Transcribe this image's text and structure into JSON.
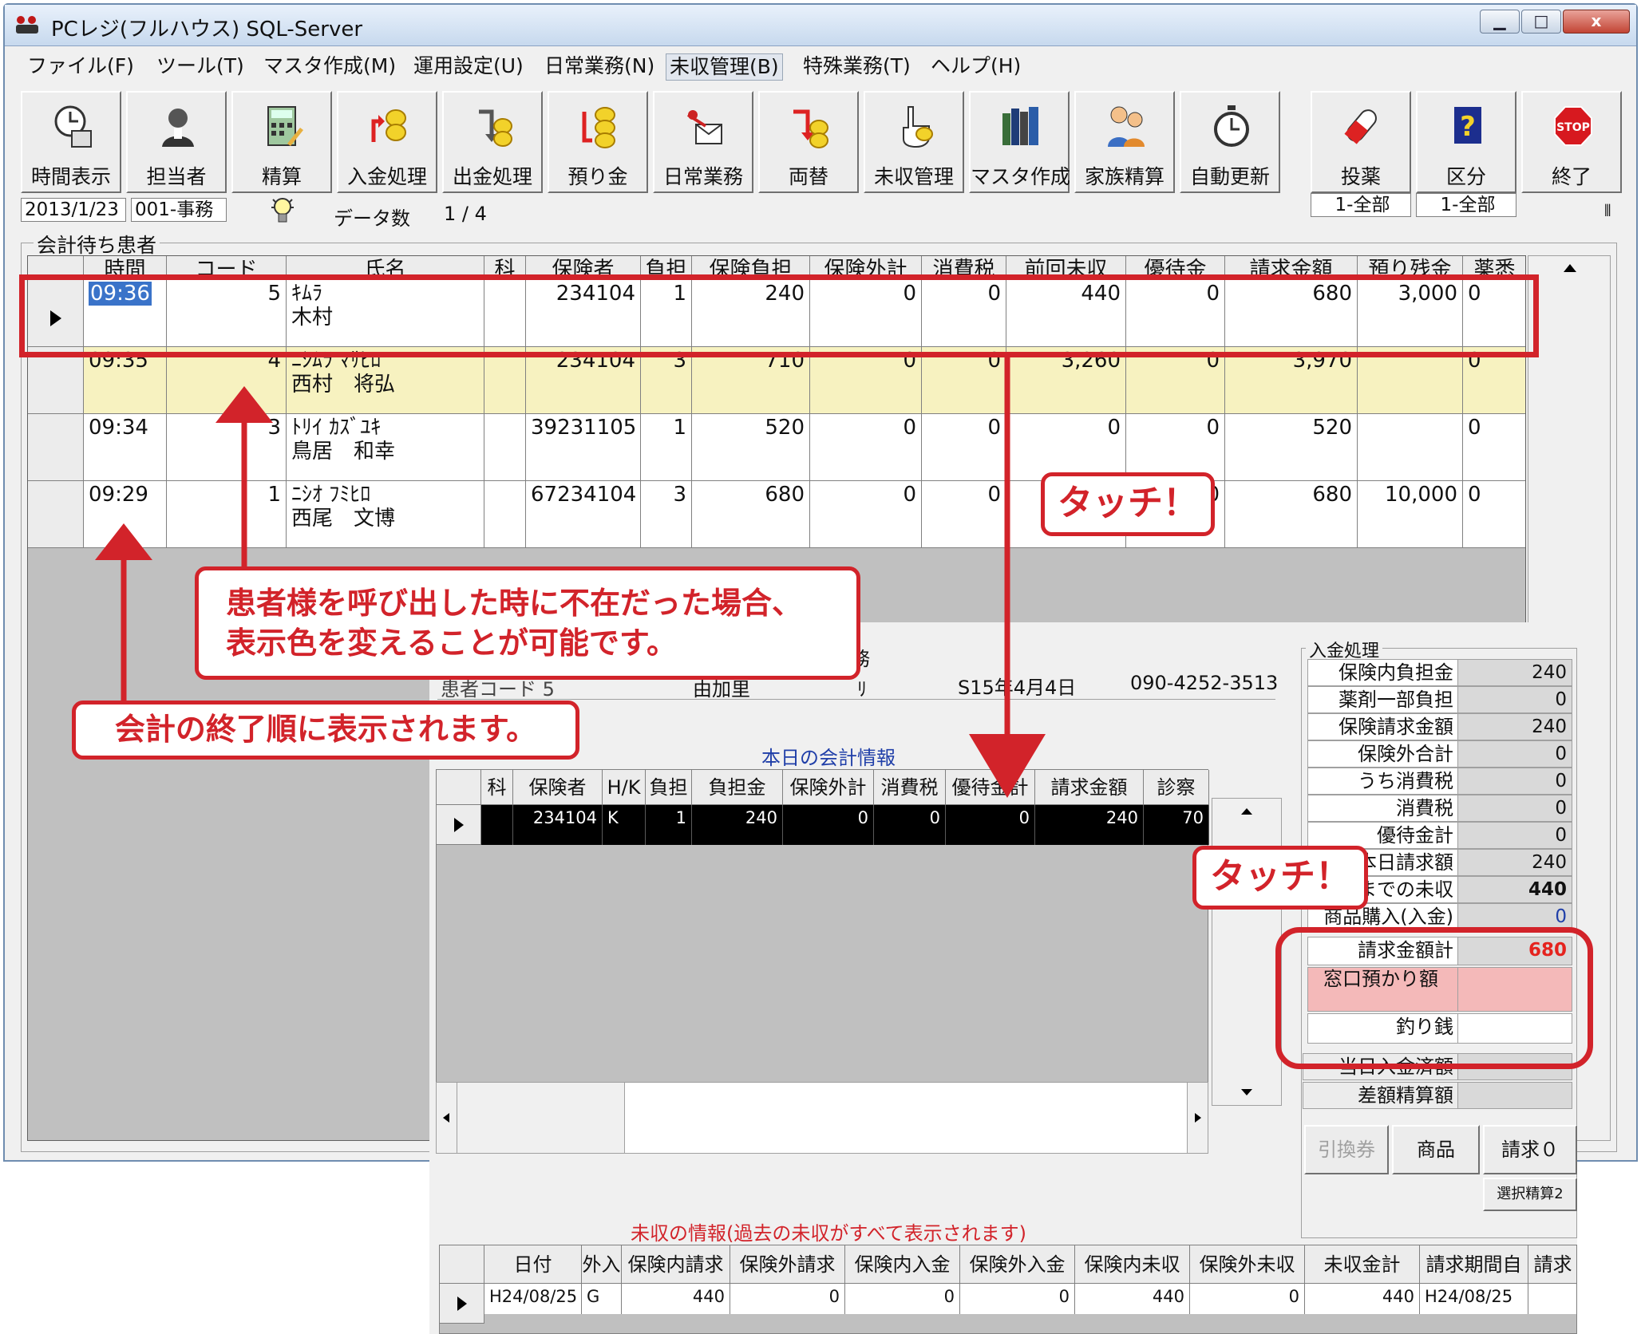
{
  "window": {
    "title": "PCレジ(フルハウス) SQL-Server",
    "controls": {
      "minimize": "▁",
      "maximize": "□",
      "close": "x"
    }
  },
  "menu": [
    {
      "label": "ファイル(F)"
    },
    {
      "label": "ツール(T)"
    },
    {
      "label": "マスタ作成(M)"
    },
    {
      "label": "運用設定(U)"
    },
    {
      "label": "日常業務(N)"
    },
    {
      "label": "未収管理(B)"
    },
    {
      "label": "特殊業務(T)"
    },
    {
      "label": "ヘルプ(H)"
    }
  ],
  "toolbar": [
    {
      "label": "時間表示",
      "icon": "clock-calendar-icon"
    },
    {
      "label": "担当者",
      "icon": "staff-person-icon"
    },
    {
      "label": "精算",
      "icon": "calculator-icon"
    },
    {
      "label": "入金処理",
      "icon": "coin-in-icon"
    },
    {
      "label": "出金処理",
      "icon": "coin-out-icon"
    },
    {
      "label": "預り金",
      "icon": "deposit-coins-icon"
    },
    {
      "label": "日常業務",
      "icon": "daily-work-icon"
    },
    {
      "label": "両替",
      "icon": "exchange-icon"
    },
    {
      "label": "未収管理",
      "icon": "hand-coin-icon"
    },
    {
      "label": "マスタ作成",
      "icon": "books-icon"
    },
    {
      "label": "家族精算",
      "icon": "family-icon"
    },
    {
      "label": "自動更新",
      "icon": "stopwatch-icon"
    },
    {
      "label": "投薬",
      "icon": "medicine-icon"
    },
    {
      "label": "区分",
      "icon": "question-book-icon"
    },
    {
      "label": "終了",
      "icon": "stop-sign-icon"
    }
  ],
  "status": {
    "date": "2013/1/23",
    "staff": "001-事務",
    "count_label": "データ数",
    "count_value": "1 / 4",
    "medicine_filter": "1-全部",
    "category_filter": "1-全部",
    "stop_text": "STOP"
  },
  "waiting": {
    "group_title": "会計待ち患者",
    "columns": [
      "時間",
      "コード",
      "氏名",
      "科",
      "保険者",
      "負担",
      "保険負担",
      "保険外計",
      "消費税",
      "前回未収",
      "優待金",
      "請求金額",
      "預り残金",
      "薬悉"
    ],
    "rows": [
      {
        "time": "09:36",
        "code": "5",
        "kana": "ｷﾑﾗ",
        "name": "木村",
        "ka": "",
        "insurer": "234104",
        "futan": "1",
        "hoken_futan": "240",
        "hokengai": "0",
        "tax": "0",
        "zenkai": "440",
        "yutai": "0",
        "seikyu": "680",
        "azukari": "3,000",
        "yaku": "0"
      },
      {
        "time": "09:35",
        "code": "4",
        "kana": "ﾆｼﾑﾗ ﾏｻﾋﾛ",
        "name": "西村　将弘",
        "ka": "",
        "insurer": "234104",
        "futan": "3",
        "hoken_futan": "710",
        "hokengai": "0",
        "tax": "0",
        "zenkai": "3,260",
        "yutai": "0",
        "seikyu": "3,970",
        "azukari": "",
        "yaku": "0"
      },
      {
        "time": "09:34",
        "code": "3",
        "kana": "ﾄﾘｲ ｶｽﾞﾕｷ",
        "name": "鳥居　和幸",
        "ka": "",
        "insurer": "39231105",
        "futan": "1",
        "hoken_futan": "520",
        "hokengai": "0",
        "tax": "0",
        "zenkai": "0",
        "yutai": "0",
        "seikyu": "520",
        "azukari": "",
        "yaku": "0"
      },
      {
        "time": "09:29",
        "code": "1",
        "kana": "ﾆｼｵ ﾌﾐﾋﾛ",
        "name": "西尾　文博",
        "ka": "",
        "insurer": "67234104",
        "futan": "3",
        "hoken_futan": "680",
        "hokengai": "0",
        "tax": "0",
        "zenkai": "",
        "yutai": "0",
        "seikyu": "680",
        "azukari": "10,000",
        "yaku": "0"
      }
    ]
  },
  "patient_info": {
    "label_partial": "務",
    "number_partial": "患者コード 5",
    "address_partial": "由加里",
    "relation_partial": "ﾘ",
    "birthdate": "S15年4月4日",
    "phone": "090-4252-3513"
  },
  "today": {
    "title": "本日の会計情報",
    "columns": [
      "科",
      "保険者",
      "H/K",
      "負担",
      "負担金",
      "保険外計",
      "消費税",
      "優待金計",
      "請求金額",
      "診察"
    ],
    "row": {
      "ka": "",
      "insurer": "234104",
      "hk": "K",
      "futan": "1",
      "futankin": "240",
      "hokengai": "0",
      "tax": "0",
      "yutai": "0",
      "seikyu": "240",
      "shinsatsu": "70"
    }
  },
  "payment": {
    "group_title": "入金処理",
    "rows": [
      {
        "label": "保険内負担金",
        "value": "240"
      },
      {
        "label": "薬剤一部負担",
        "value": "0"
      },
      {
        "label": "保険請求金額",
        "value": "240"
      },
      {
        "label": "保険外合計",
        "value": "0"
      },
      {
        "label": "うち消費税",
        "value": "0"
      },
      {
        "label": "消費税",
        "value": "0"
      },
      {
        "label": "優待金計",
        "value": "0"
      },
      {
        "label": "本日請求額",
        "value": "240"
      },
      {
        "label": "前回までの未収",
        "value": "440"
      },
      {
        "label": "商品購入(入金)",
        "value": "0"
      }
    ],
    "total_label": "請求金額計",
    "total_value": "680",
    "deposit_label": "窓口預かり額",
    "deposit_value": "",
    "change_label": "釣り銭",
    "change_value": "",
    "today_paid_label": "当日入金済額",
    "diff_label": "差額精算額",
    "buttons": {
      "voucher": "引換券",
      "goods": "商品",
      "bill": "請求０",
      "select": "選択精算2"
    }
  },
  "uncollected": {
    "title": "未収の情報(過去の未収がすべて表示されます)",
    "columns": [
      "日付",
      "外入",
      "保険内請求",
      "保険外請求",
      "保険内入金",
      "保険外入金",
      "保険内未収",
      "保険外未収",
      "未収金計",
      "請求期間自",
      "請求"
    ],
    "row": {
      "date": "H24/08/25",
      "gainyu": "G",
      "in_seikyu": "440",
      "out_seikyu": "0",
      "in_nyukin": "0",
      "out_nyukin": "0",
      "in_mishu": "440",
      "out_mishu": "0",
      "total": "440",
      "from": "H24/08/25"
    }
  },
  "annotations": {
    "touch1": "タッチ！",
    "touch2": "タッチ！",
    "absent_line1": "患者様を呼び出した時に不在だった場合、",
    "absent_line2": "表示色を変えることが可能です。",
    "order": "会計の終了順に表示されます。",
    "accent_color": "#d2232a"
  },
  "colors": {
    "absent_row": "#f7f2c0",
    "selected_time_bg": "#3a73c9",
    "deposit_bg": "#f4b9b9",
    "total_text": "#e5231e",
    "title_blue": "#1f3ea8"
  }
}
